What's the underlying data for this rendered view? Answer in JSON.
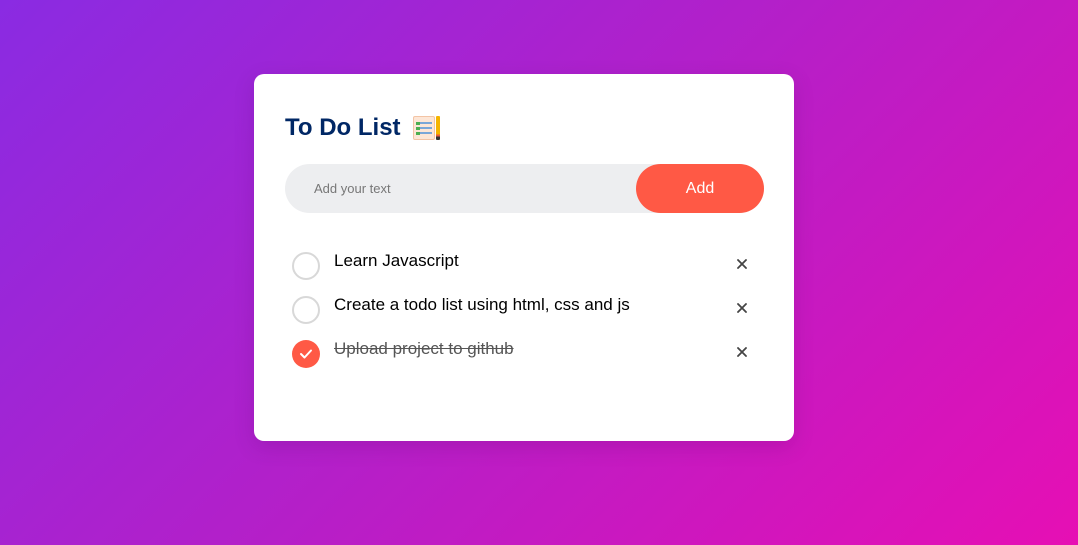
{
  "header": {
    "title": "To Do List",
    "title_icon": "checklist-notepad-icon"
  },
  "input": {
    "placeholder": "Add your text",
    "value": ""
  },
  "add_button": {
    "label": "Add"
  },
  "tasks": [
    {
      "text": "Learn Javascript",
      "checked": false
    },
    {
      "text": "Create a todo list using html, css and js",
      "checked": false
    },
    {
      "text": "Upload project to github",
      "checked": true
    }
  ],
  "colors": {
    "accent": "#ff5945",
    "title": "#002765",
    "input_bg": "#edeef0",
    "gradient_start": "#8a2be2",
    "gradient_end": "#e60fb4"
  },
  "icons": {
    "remove": "close-icon",
    "checked": "checkmark-icon"
  }
}
